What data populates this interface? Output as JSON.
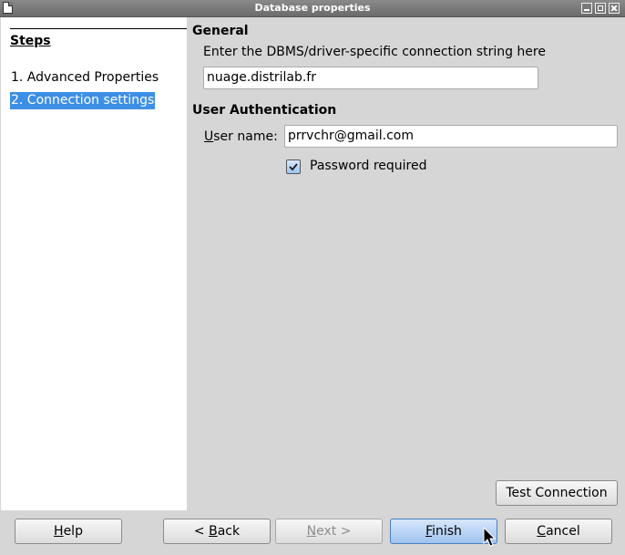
{
  "window": {
    "title": "Database properties"
  },
  "steps": {
    "heading": "Steps",
    "items": [
      {
        "label": "1. Advanced Properties",
        "selected": false
      },
      {
        "label": "2. Connection settings",
        "selected": true
      }
    ]
  },
  "general": {
    "heading": "General",
    "description": "Enter the DBMS/driver-specific connection string here",
    "connection_string": "nuage.distrilab.fr"
  },
  "auth": {
    "heading": "User Authentication",
    "username_label_prefix": "U",
    "username_label_rest": "ser name:",
    "username_value": "prrvchr@gmail.com",
    "password_required_label": "Password required",
    "password_required_checked": true
  },
  "buttons": {
    "test_connection": "Test Connection",
    "help_mnemonic": "H",
    "help_rest": "elp",
    "back_prefix": "< ",
    "back_mnemonic": "B",
    "back_rest": "ack",
    "next_mnemonic": "N",
    "next_rest": "ext >",
    "finish_mnemonic": "F",
    "finish_rest": "inish",
    "cancel_mnemonic": "C",
    "cancel_rest": "ancel"
  },
  "colors": {
    "selection": "#3d8fe6",
    "primary_button": "#9ec3ef"
  }
}
